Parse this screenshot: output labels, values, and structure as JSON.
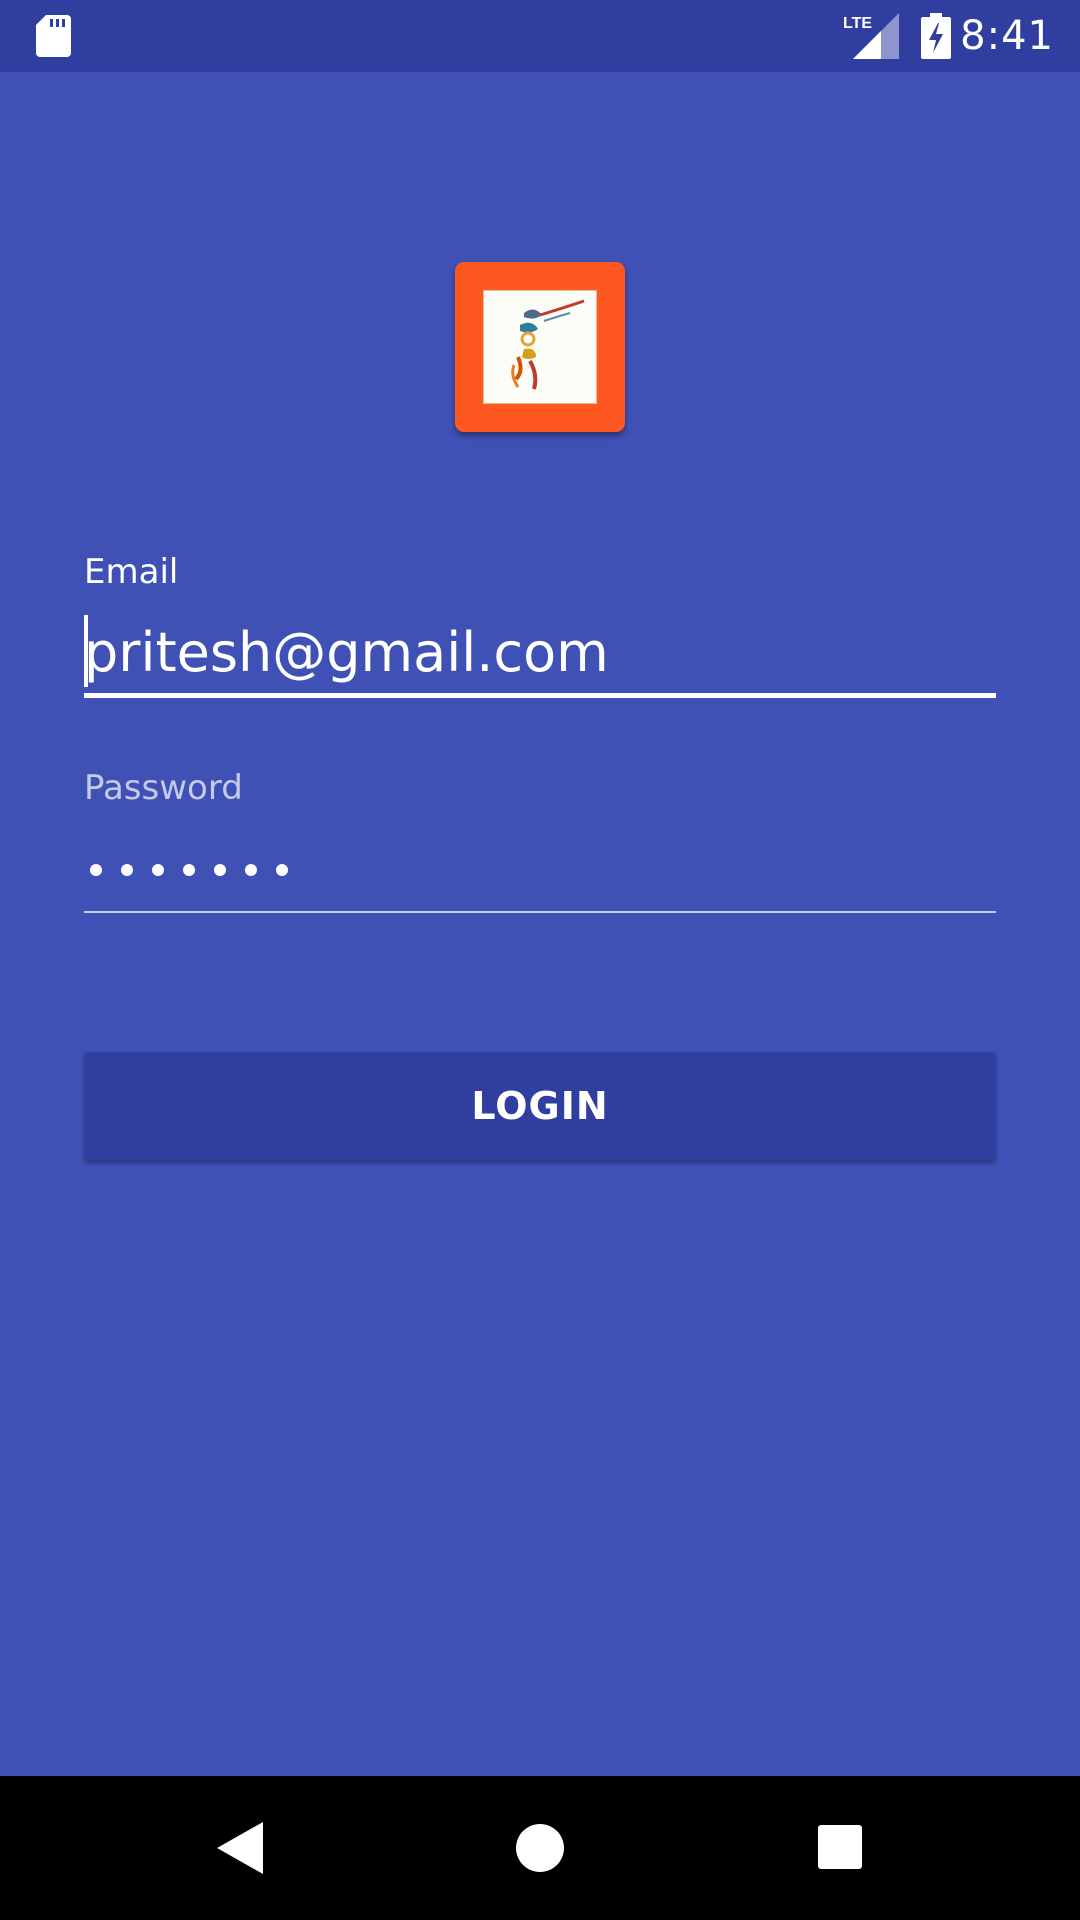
{
  "status_bar": {
    "time": "8:41",
    "network_label": "LTE",
    "icons": [
      "sd-card-icon",
      "lte-signal-icon",
      "battery-charging-icon"
    ]
  },
  "logo": {
    "icon": "app-logo-icon",
    "background_color": "#ff5722"
  },
  "login_form": {
    "email_label": "Email",
    "email_value": "pritesh@gmail.com",
    "password_label": "Password",
    "password_masked": "•••••••",
    "password_length": 7,
    "login_button_label": "LOGIN"
  },
  "navigation_bar": {
    "icons": [
      "back-icon",
      "home-icon",
      "recents-icon"
    ]
  },
  "colors": {
    "primary": "#3f51b5",
    "primary_dark": "#303f9f",
    "accent": "#ff5722",
    "text_on_primary": "#ffffff",
    "hint_text": "#c5cae9"
  }
}
